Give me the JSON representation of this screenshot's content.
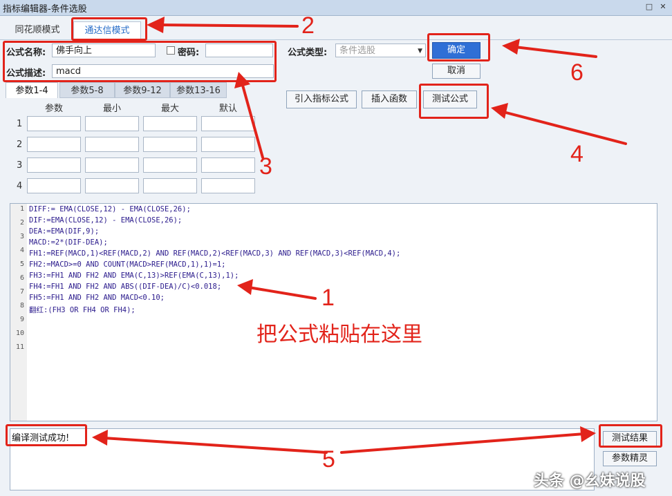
{
  "window": {
    "title": "指标编辑器-条件选股"
  },
  "mode_tabs": [
    {
      "label": "同花顺模式",
      "active": false
    },
    {
      "label": "通达信模式",
      "active": true
    }
  ],
  "form": {
    "name_label": "公式名称:",
    "name_value": "佛手向上",
    "password_label": "密码:",
    "password_value": "",
    "desc_label": "公式描述:",
    "desc_value": "macd",
    "type_label": "公式类型:",
    "type_value": "条件选股"
  },
  "buttons": {
    "ok": "确定",
    "cancel": "取消",
    "import": "引入指标公式",
    "insert": "插入函数",
    "test": "测试公式",
    "test_result": "测试结果",
    "param_wizard": "参数精灵"
  },
  "param_tabs": [
    "参数1-4",
    "参数5-8",
    "参数9-12",
    "参数13-16"
  ],
  "param_headers": [
    "参数",
    "最小",
    "最大",
    "默认"
  ],
  "param_rows": [
    "1",
    "2",
    "3",
    "4"
  ],
  "code_lines": [
    "DIFF:= EMA(CLOSE,12) - EMA(CLOSE,26);",
    "DIF:=EMA(CLOSE,12) - EMA(CLOSE,26);",
    "DEA:=EMA(DIF,9);",
    "MACD:=2*(DIF-DEA);",
    "FH1:=REF(MACD,1)<REF(MACD,2) AND REF(MACD,2)<REF(MACD,3) AND REF(MACD,3)<REF(MACD,4);",
    "FH2:=MACD>=0 AND COUNT(MACD>REF(MACD,1),1)=1;",
    "FH3:=FH1 AND FH2 AND EMA(C,13)>REF(EMA(C,13),1);",
    "FH4:=FH1 AND FH2 AND ABS((DIF-DEA)/C)<0.018;",
    "FH5:=FH1 AND FH2 AND MACD<0.10;",
    "翻红:(FH3 OR FH4 OR FH4);",
    "",
    ""
  ],
  "line_numbers": [
    "1",
    "2",
    "3",
    "4",
    "5",
    "6",
    "7",
    "8",
    "9",
    "10",
    "11"
  ],
  "output": {
    "message": "编译测试成功!"
  },
  "annotations": {
    "n1": "1",
    "n2": "2",
    "n3": "3",
    "n4": "4",
    "n5": "5",
    "n6": "6",
    "paste_hint": "把公式粘贴在这里"
  },
  "watermark": "头条 @幺妹说股",
  "colors": {
    "annotation": "#e2231a",
    "primary_button": "#2f6fd6",
    "tab_active_text": "#2a6fc9"
  }
}
